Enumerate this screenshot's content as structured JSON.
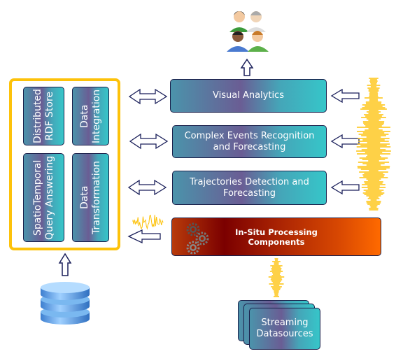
{
  "store_panel": {
    "components": [
      {
        "label": "Distributed RDF Store"
      },
      {
        "label": "Data Integration"
      },
      {
        "label": "SpatioTemporal Query Answering"
      },
      {
        "label": "Data Transformation"
      }
    ]
  },
  "modules": {
    "visual_analytics": "Visual Analytics",
    "complex_events": "Complex Events Recognition and Forecasting",
    "trajectories": "Trajectories Detection and Forecasting",
    "in_situ": "In-Situ Processing Components"
  },
  "sources": {
    "streaming": "Streaming Datasources"
  },
  "colors": {
    "frame": "#fdc20a",
    "wave": "#fdc20a",
    "arrow": "#1a1f5a",
    "module_teal": "#36c6c9",
    "module_purple": "#6a5d94",
    "insitu_dark": "#7b0000",
    "insitu_light": "#ff6a00"
  },
  "icons": [
    "users-icon",
    "database-icon",
    "gears-icon",
    "signal-wave-icon",
    "double-arrow-icon",
    "arrow-icon"
  ]
}
